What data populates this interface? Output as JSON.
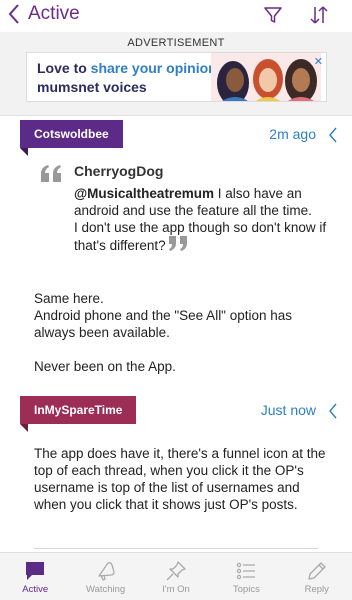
{
  "nav": {
    "back_label": "Active"
  },
  "ad": {
    "label": "ADVERTISEMENT",
    "line1_prefix": "Love to ",
    "line1_highlight": "share your opinion?",
    "line2": "mumsnet voices",
    "close_glyph": "✕"
  },
  "posts": [
    {
      "username": "Cotswoldbee",
      "time": "2m ago",
      "quote": {
        "author": "CherryogDog",
        "mention": "@Musicaltheatremum",
        "text_after_mention": " I also have an android and use the feature all the time.",
        "text_line2": "I don't use the app though so don't know if that's different?"
      },
      "body": [
        "Same here.",
        "Android phone and the \"See All\" option has always been available.",
        "",
        "Never been on the App."
      ]
    },
    {
      "username": "InMySpareTime",
      "time": "Just now",
      "body": [
        "The app does have it, there's a funnel icon at the top of each thread, when you click it the OP's username is top of the list of usernames and when you click that it shows just OP's posts."
      ]
    }
  ],
  "tabs": [
    {
      "label": "Active",
      "icon": "chat-icon",
      "active": true
    },
    {
      "label": "Watching",
      "icon": "megaphone-icon",
      "active": false
    },
    {
      "label": "I'm On",
      "icon": "pin-icon",
      "active": false
    },
    {
      "label": "Topics",
      "icon": "list-icon",
      "active": false
    },
    {
      "label": "Reply",
      "icon": "pencil-icon",
      "active": false
    }
  ],
  "colors": {
    "brand_purple": "#5c2a87",
    "accent_blue": "#2e7fc6",
    "user_tag_2": "#9c2d55"
  }
}
